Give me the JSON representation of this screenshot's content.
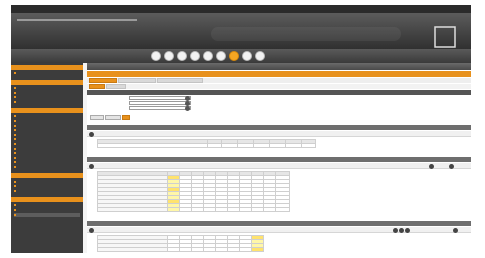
{
  "window": {
    "title": ""
  },
  "header": {
    "company_name": "",
    "product_tagline": "",
    "logo_text": ""
  },
  "toolbar": {
    "icons": [
      {
        "name": "home-icon",
        "active": false
      },
      {
        "name": "folder-icon",
        "active": false
      },
      {
        "name": "document-icon",
        "active": false
      },
      {
        "name": "grid-icon",
        "active": false
      },
      {
        "name": "chart-icon",
        "active": false
      },
      {
        "name": "print-icon",
        "active": false
      },
      {
        "name": "person-icon",
        "active": true
      },
      {
        "name": "settings-icon",
        "active": false
      },
      {
        "name": "help-icon",
        "active": false
      }
    ]
  },
  "sidebar": {
    "sections": [
      {
        "title": "",
        "items": [
          ""
        ]
      },
      {
        "title": "",
        "items": [
          "",
          "",
          "",
          ""
        ]
      },
      {
        "title": "",
        "items": [
          "",
          "",
          "",
          "",
          "",
          "",
          "",
          "",
          "",
          "",
          "",
          ""
        ]
      },
      {
        "title": "",
        "items": [
          "",
          "",
          ""
        ]
      },
      {
        "title": "",
        "items": [
          "",
          "",
          ""
        ]
      }
    ]
  },
  "main": {
    "header": "",
    "doc_title": "",
    "tabs": [
      "",
      "",
      ""
    ],
    "subtabs": [
      "",
      ""
    ],
    "ref_panel": {
      "title": "",
      "fields": [
        {
          "label": "",
          "value": ""
        },
        {
          "label": "",
          "value": ""
        },
        {
          "label": "",
          "value": ""
        }
      ],
      "side_note": "",
      "buttons": [
        "",
        "",
        ""
      ]
    },
    "section1": {
      "title": "",
      "columns": [
        "",
        "",
        "",
        "",
        "",
        "",
        "",
        ""
      ],
      "row": [
        "",
        "",
        "",
        "",
        "",
        "",
        "",
        ""
      ]
    },
    "section2": {
      "title": "",
      "pager_text": "",
      "pager_right": [
        "",
        ""
      ],
      "columns": [
        "",
        "",
        "",
        "",
        "",
        "",
        "",
        "",
        "",
        "",
        ""
      ],
      "rows": [
        [
          "",
          "",
          "",
          "",
          "",
          "",
          "",
          "",
          "",
          "",
          ""
        ],
        [
          "",
          "",
          "",
          "",
          "",
          "",
          "",
          "",
          "",
          "",
          ""
        ],
        [
          "",
          "",
          "",
          "",
          "",
          "",
          "",
          "",
          "",
          "",
          ""
        ],
        [
          "",
          "",
          "",
          "",
          "",
          "",
          "",
          "",
          "",
          "",
          ""
        ],
        [
          "",
          "",
          "",
          "",
          "",
          "",
          "",
          "",
          "",
          "",
          ""
        ],
        [
          "",
          "",
          "",
          "",
          "",
          "",
          "",
          "",
          "",
          "",
          ""
        ],
        [
          "",
          "",
          "",
          "",
          "",
          "",
          "",
          "",
          "",
          "",
          ""
        ],
        [
          "",
          "",
          "",
          "",
          "",
          "",
          "",
          "",
          "",
          "",
          ""
        ],
        [
          "",
          "",
          "",
          "",
          "",
          "",
          "",
          "",
          "",
          "",
          ""
        ]
      ]
    },
    "section3": {
      "title": "",
      "pager_right": [
        "",
        ""
      ],
      "rows": [
        [
          "",
          "",
          "",
          "",
          "",
          "",
          "",
          "",
          ""
        ],
        [
          "",
          "",
          "",
          "",
          "",
          "",
          "",
          "",
          ""
        ],
        [
          "",
          "",
          "",
          "",
          "",
          "",
          "",
          "",
          ""
        ],
        [
          "",
          "",
          "",
          "",
          "",
          "",
          "",
          "",
          ""
        ]
      ]
    }
  },
  "colors": {
    "accent": "#e8911c",
    "dark": "#3c3c3c",
    "highlight": "#fff7a8"
  }
}
